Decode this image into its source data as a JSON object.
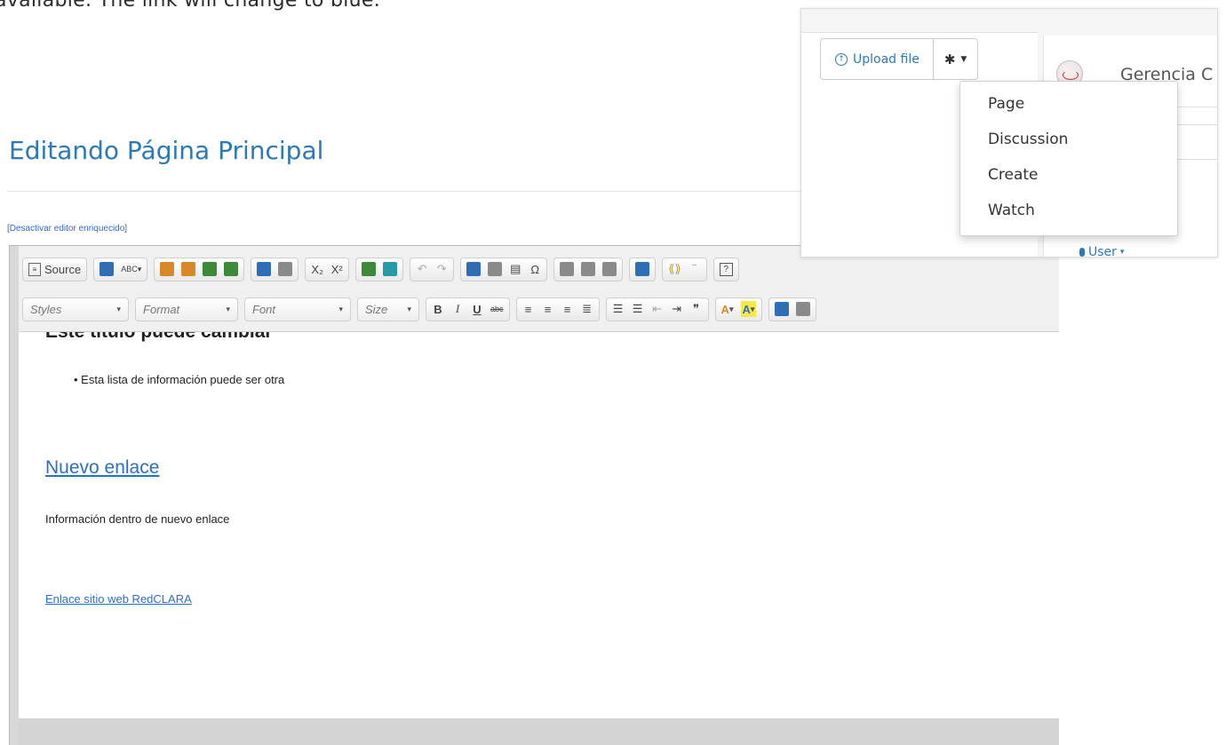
{
  "caption": "available. The link will change to blue.",
  "page": {
    "heading": "Editando Página Principal",
    "toggle_editor": "[Desactivar editor enriquecido]"
  },
  "toolbar": {
    "source_label": "Source",
    "abc_label": "ABC",
    "subscript_label": "X₂",
    "superscript_label": "X²",
    "omega_label": "Ω",
    "help_label": "?",
    "styles_label": "Styles",
    "format_label": "Format",
    "font_label": "Font",
    "size_label": "Size",
    "bold_label": "B",
    "italic_label": "I",
    "underline_label": "U",
    "strike_label": "abc",
    "quote_label": "❞",
    "text_color_label": "A",
    "bg_color_label": "A"
  },
  "content": {
    "cut_heading": "Este título puede cambiar",
    "bullet_item": "Esta lista de información puede ser otra",
    "link_heading": "Nuevo enlace",
    "link_description": "Información dentro de nuevo enlace",
    "site_link": "Enlace sitio web RedCLARA"
  },
  "panel": {
    "upload_button": "Upload file",
    "org_name": "Gerencia C",
    "user_link": "User"
  },
  "dropdown": {
    "items": [
      "Page",
      "Discussion",
      "Create",
      "Watch"
    ]
  },
  "icons": {
    "upload": "upload-circle-icon",
    "gear": "gear-icon",
    "logo": "globe-logo-icon",
    "user": "user-icon"
  },
  "colors": {
    "link_blue": "#2a6fc9",
    "heading_blue": "#2a7ab8",
    "toolbar_bg": "#f0f0f0"
  }
}
